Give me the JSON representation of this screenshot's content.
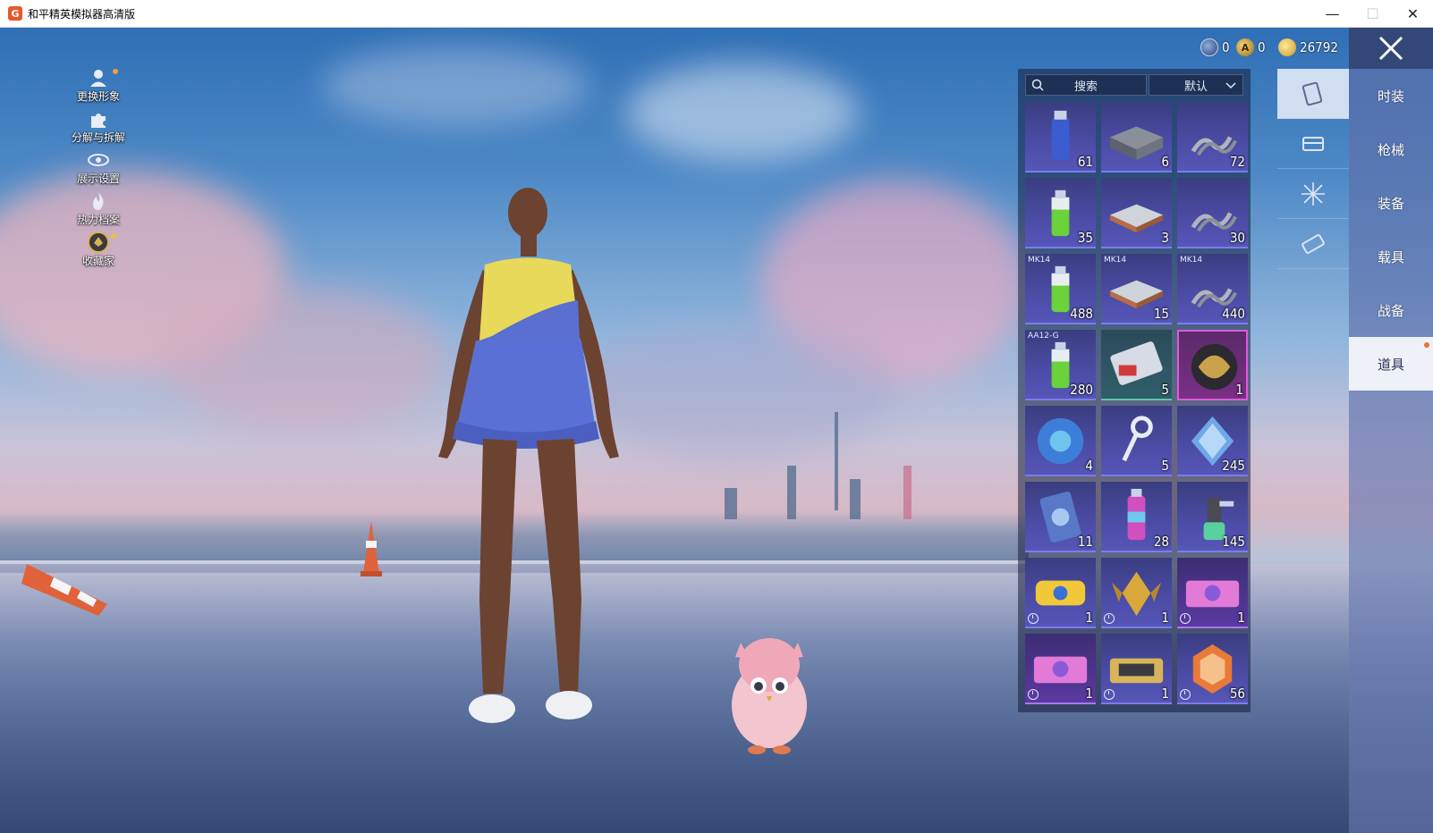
{
  "window": {
    "title": "和平精英模拟器高清版",
    "logo_letter": "G",
    "buttons": {
      "minimize": "—",
      "maximize": "☐",
      "close": "✕"
    }
  },
  "left_menu": [
    {
      "label": "更换形象",
      "icon": "person-icon",
      "has_dot": true
    },
    {
      "label": "分解与拆解",
      "icon": "puzzle-icon",
      "has_dot": false
    },
    {
      "label": "展示设置",
      "icon": "eye-icon",
      "has_dot": false
    },
    {
      "label": "热力档案",
      "icon": "flame-icon",
      "has_dot": false
    },
    {
      "label": "收藏家",
      "icon": "collector-badge-icon",
      "has_dot": true
    }
  ],
  "currency": [
    {
      "name": "globe-coin-icon",
      "value": "0"
    },
    {
      "name": "a-coin-icon",
      "value": "0"
    },
    {
      "name": "gold-coin-icon",
      "value": "26792"
    }
  ],
  "inventory": {
    "search_placeholder": "搜索",
    "sort_label": "默认",
    "items": [
      {
        "prefix": "",
        "count": "61",
        "art": "spray-can-blue",
        "rarity": "blue",
        "timer": false
      },
      {
        "prefix": "",
        "count": "6",
        "art": "parts-crate",
        "rarity": "blue",
        "timer": false
      },
      {
        "prefix": "",
        "count": "72",
        "art": "spring",
        "rarity": "blue",
        "timer": false
      },
      {
        "prefix": "",
        "count": "35",
        "art": "spray-can-green",
        "rarity": "blue",
        "timer": false
      },
      {
        "prefix": "",
        "count": "3",
        "art": "tray",
        "rarity": "blue",
        "timer": false
      },
      {
        "prefix": "",
        "count": "30",
        "art": "spring",
        "rarity": "blue",
        "timer": false
      },
      {
        "prefix": "MK14",
        "count": "488",
        "art": "spray-can-green",
        "rarity": "blue",
        "timer": false
      },
      {
        "prefix": "MK14",
        "count": "15",
        "art": "tray",
        "rarity": "blue",
        "timer": false
      },
      {
        "prefix": "MK14",
        "count": "440",
        "art": "spring",
        "rarity": "blue",
        "timer": false
      },
      {
        "prefix": "AA12-G",
        "count": "280",
        "art": "spray-can-green",
        "rarity": "blue",
        "timer": false
      },
      {
        "prefix": "",
        "count": "5",
        "art": "ticket-card",
        "rarity": "green",
        "timer": false
      },
      {
        "prefix": "",
        "count": "1",
        "art": "lion-emblem",
        "rarity": "purple-hl",
        "timer": false
      },
      {
        "prefix": "",
        "count": "4",
        "art": "puzzle-orb",
        "rarity": "blue",
        "timer": false
      },
      {
        "prefix": "",
        "count": "5",
        "art": "key",
        "rarity": "blue",
        "timer": false
      },
      {
        "prefix": "",
        "count": "245",
        "art": "diamond",
        "rarity": "blue",
        "timer": false
      },
      {
        "prefix": "",
        "count": "11",
        "art": "card",
        "rarity": "blue",
        "timer": false
      },
      {
        "prefix": "",
        "count": "28",
        "art": "spray-can-pink",
        "rarity": "blue",
        "timer": false
      },
      {
        "prefix": "",
        "count": "145",
        "art": "spray-gun",
        "rarity": "blue",
        "timer": false
      },
      {
        "prefix": "",
        "count": "1",
        "art": "2026-emblem",
        "rarity": "blue",
        "timer": true
      },
      {
        "prefix": "",
        "count": "1",
        "art": "gold-wings",
        "rarity": "blue",
        "timer": true
      },
      {
        "prefix": "",
        "count": "1",
        "art": "cat-voucher",
        "rarity": "violet",
        "timer": true
      },
      {
        "prefix": "",
        "count": "1",
        "art": "cat-voucher",
        "rarity": "violet",
        "timer": true
      },
      {
        "prefix": "",
        "count": "1",
        "art": "ship-voucher",
        "rarity": "blue",
        "timer": true
      },
      {
        "prefix": "",
        "count": "56",
        "art": "orange-badge",
        "rarity": "blue",
        "timer": true
      }
    ]
  },
  "sub_tabs": [
    {
      "icon": "card-icon",
      "active": true
    },
    {
      "icon": "chest-icon",
      "active": false
    },
    {
      "icon": "firework-icon",
      "active": false
    },
    {
      "icon": "ticket-icon",
      "active": false
    }
  ],
  "categories": [
    {
      "label": "时装",
      "active": false,
      "has_dot": false
    },
    {
      "label": "枪械",
      "active": false,
      "has_dot": false
    },
    {
      "label": "装备",
      "active": false,
      "has_dot": false
    },
    {
      "label": "载具",
      "active": false,
      "has_dot": false
    },
    {
      "label": "战备",
      "active": false,
      "has_dot": false
    },
    {
      "label": "道具",
      "active": true,
      "has_dot": true
    }
  ]
}
